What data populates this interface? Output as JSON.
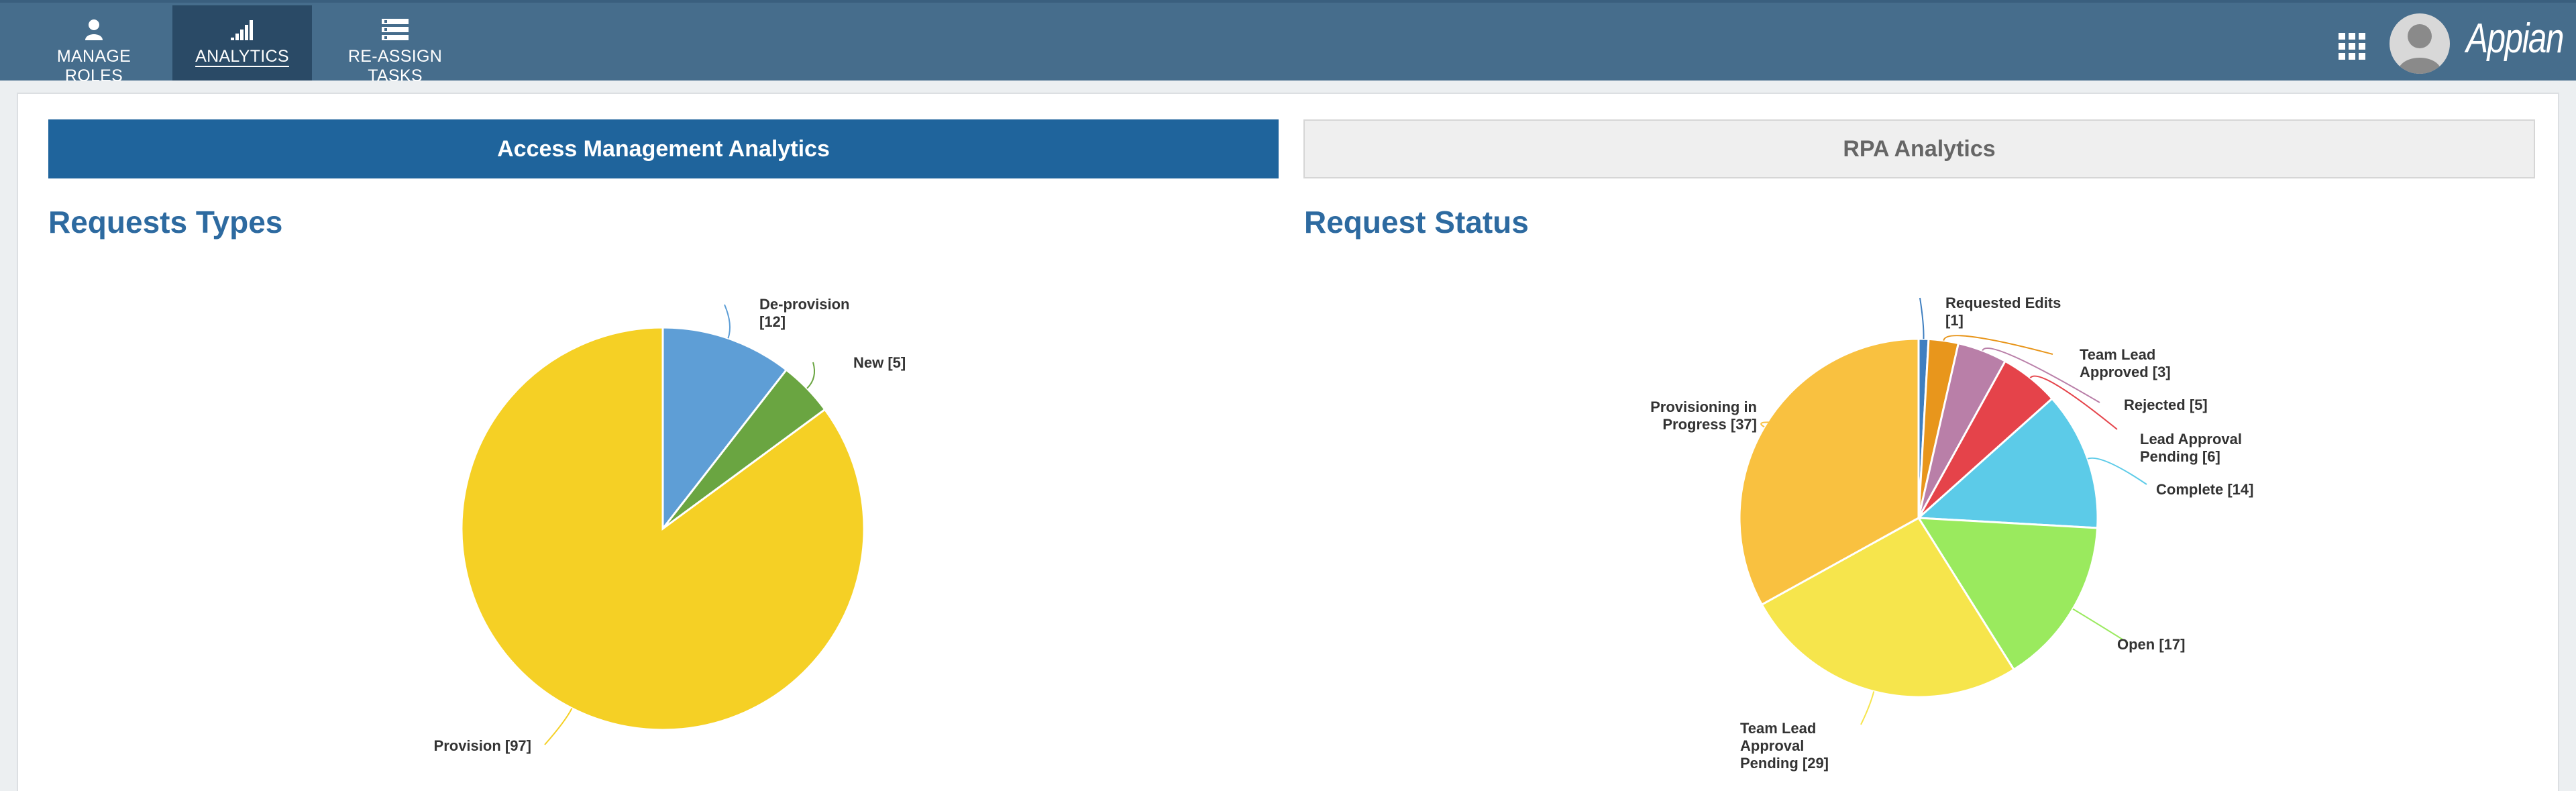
{
  "nav": {
    "tabs": [
      {
        "label": "MANAGE ROLES",
        "icon": "user-icon"
      },
      {
        "label": "ANALYTICS",
        "icon": "bar-chart-icon",
        "active": true
      },
      {
        "label": "RE-ASSIGN TASKS",
        "icon": "tasks-list-icon"
      }
    ],
    "grid_icon": "apps-grid-icon",
    "avatar_icon": "user-avatar-icon",
    "brand": "Appian",
    "colors": {
      "bar": "#466d8c",
      "active_tab": "#2a4a66"
    }
  },
  "tabs": {
    "access": "Access Management Analytics",
    "rpa": "RPA Analytics",
    "active": "access",
    "colors": {
      "active": "#1f649c",
      "inactive": "#efefef"
    }
  },
  "chart_data": [
    {
      "type": "pie",
      "title": "Requests Types",
      "slices": [
        {
          "label": "De-provision [12]",
          "value": 12,
          "color": "#5e9ed6"
        },
        {
          "label": "New [5]",
          "value": 5,
          "color": "#6aa541"
        },
        {
          "label": "Provision [97]",
          "value": 97,
          "color": "#f5d025"
        }
      ]
    },
    {
      "type": "pie",
      "title": "Request Status",
      "slices": [
        {
          "label": "Requested Edits [1]",
          "value": 1,
          "color": "#3f7fc0"
        },
        {
          "label": "Team Lead Approved [3]",
          "value": 3,
          "color": "#e8961c"
        },
        {
          "label": "Rejected [5]",
          "value": 5,
          "color": "#b97fa8"
        },
        {
          "label": "Lead Approval Pending [6]",
          "value": 6,
          "color": "#e5434a"
        },
        {
          "label": "Complete [14]",
          "value": 14,
          "color": "#5ccbe8"
        },
        {
          "label": "Open [17]",
          "value": 17,
          "color": "#9aea5e"
        },
        {
          "label": "Team Lead Approval Pending [29]",
          "value": 29,
          "color": "#f6e54c"
        },
        {
          "label": "Provisioning in Progress [37]",
          "value": 37,
          "color": "#f9c140"
        }
      ]
    }
  ]
}
